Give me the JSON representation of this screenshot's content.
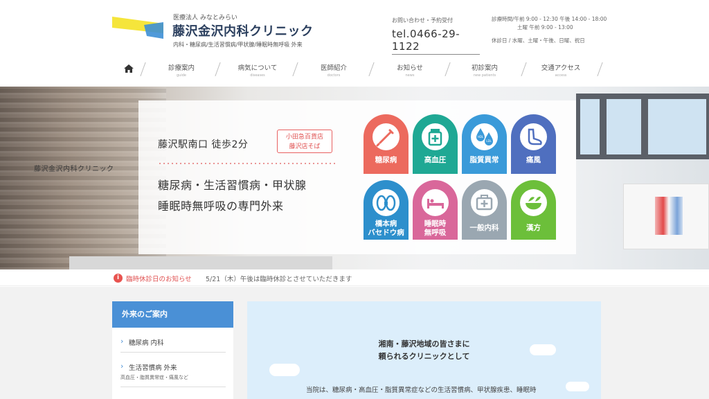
{
  "header": {
    "org": "医療法人 みなとみらい",
    "clinic_name": "藤沢金沢内科クリニック",
    "departments": "内科・糖尿病/生活習慣病/甲状腺/睡眠時無呼吸 外来",
    "contact_label": "お問い合わせ・予約受付",
    "tel": "tel.0466-29-1122",
    "hours_weekday": "診療時間/午前 9:00 - 12:30 午後 14:00 - 18:00",
    "hours_saturday": "土曜 午前 9:00 - 13:00",
    "closed_days": "休診日 / 水曜、土曜・午後、日曜、祝日",
    "logo_colors": {
      "yellow": "#f5e53b",
      "blue": "#3d8fd6"
    }
  },
  "nav": {
    "home_icon": "home-icon",
    "items": [
      {
        "jp": "診療案内",
        "en": "guide"
      },
      {
        "jp": "病気について",
        "en": "diseases"
      },
      {
        "jp": "医師紹介",
        "en": "doctors"
      },
      {
        "jp": "お知らせ",
        "en": "news"
      },
      {
        "jp": "初診案内",
        "en": "new patients"
      },
      {
        "jp": "交通アクセス",
        "en": "access"
      }
    ]
  },
  "hero": {
    "wall_sign": "藤沢金沢内科クリニック",
    "walk": "藤沢駅南口 徒歩2分",
    "near_line1": "小田急百貨店",
    "near_line2": "藤沢店そば",
    "tagline_line1": "糖尿病・生活習慣病・甲状腺",
    "tagline_line2": "睡眠時無呼吸の専門外来",
    "tiles": [
      {
        "label1": "糖尿病",
        "label2": "",
        "color": "#ec6a5e",
        "icon": "insulin-pen-icon"
      },
      {
        "label1": "高血圧",
        "label2": "",
        "color": "#1fa894",
        "icon": "medicine-bottle-icon"
      },
      {
        "label1": "脂質異常",
        "label2": "",
        "color": "#3a9ad9",
        "icon": "droplet-icon",
        "hdl": "HDL",
        "ldl": "LDL"
      },
      {
        "label1": "痛風",
        "label2": "",
        "color": "#4f6fbf",
        "icon": "foot-icon"
      },
      {
        "label1": "橋本病",
        "label2": "バセドウ病",
        "color": "#2d8fcc",
        "icon": "thyroid-icon"
      },
      {
        "label1": "睡眠時",
        "label2": "無呼吸",
        "color": "#d9679a",
        "icon": "bed-icon"
      },
      {
        "label1": "一般内科",
        "label2": "",
        "color": "#9aa7b1",
        "icon": "medical-kit-icon"
      },
      {
        "label1": "漢方",
        "label2": "",
        "color": "#6cbf3a",
        "icon": "mortar-icon"
      }
    ]
  },
  "notice": {
    "title": "臨時休診日のお知らせ",
    "text": "5/21（木）午後は臨時休診とさせていただきます",
    "icon_glyph": "i"
  },
  "sidebar": {
    "heading": "外来のご案内",
    "items": [
      {
        "title": "糖尿病 内科",
        "sub": ""
      },
      {
        "title": "生活習慣病 外来",
        "sub": "高血圧・脂質異常症・痛風など"
      }
    ]
  },
  "main": {
    "title_line1": "湘南・藤沢地域の皆さまに",
    "title_line2": "頼られるクリニックとして",
    "intro": "当院は、糖尿病・高血圧・脂質異常症などの生活習慣病、甲状腺疾患、睡眠時"
  }
}
